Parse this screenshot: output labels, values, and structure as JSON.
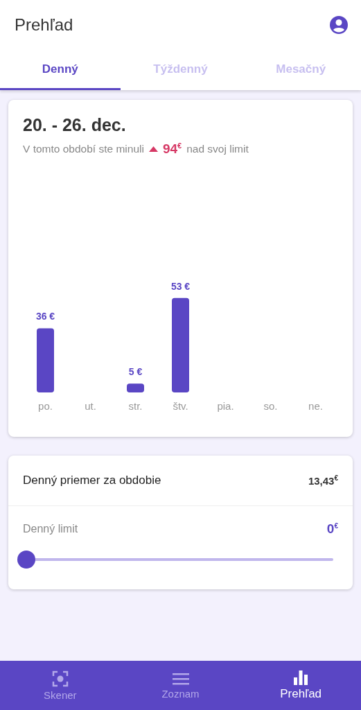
{
  "app_bar": {
    "title": "Prehľad"
  },
  "tabs": [
    {
      "label": "Denný",
      "selected": true
    },
    {
      "label": "Týždenný",
      "selected": false
    },
    {
      "label": "Mesačný",
      "selected": false
    }
  ],
  "summary_card": {
    "period": "20. - 26. dec.",
    "over_limit": {
      "before": "V tomto období ste minuli",
      "amount": "94$^{€}$",
      "after": "nad svoj limit"
    },
    "chart_data": {
      "type": "bar",
      "categories": [
        "po.",
        "ut.",
        "str.",
        "štv.",
        "pia.",
        "so.",
        "ne."
      ],
      "values": [
        36,
        null,
        5,
        53,
        null,
        null,
        null
      ],
      "data_labels": true,
      "value_labels": [
        "36 €",
        null,
        "5 €",
        "53 €",
        null,
        null,
        null
      ]
    }
  },
  "stats_card": {
    "average_label": "Denný priemer za obdobie",
    "average_value": "13,43$^{€}$",
    "limit_label": "Denný limit",
    "limit_value": "0$^{€}$",
    "limit_slider": {
      "level": 0
    }
  },
  "bottom_nav": [
    {
      "label": "Skener",
      "kind": "scanner",
      "selected": false
    },
    {
      "label": "Zoznam",
      "kind": "list",
      "selected": false
    },
    {
      "label": "Prehľad",
      "kind": "chart",
      "selected": true
    }
  ]
}
